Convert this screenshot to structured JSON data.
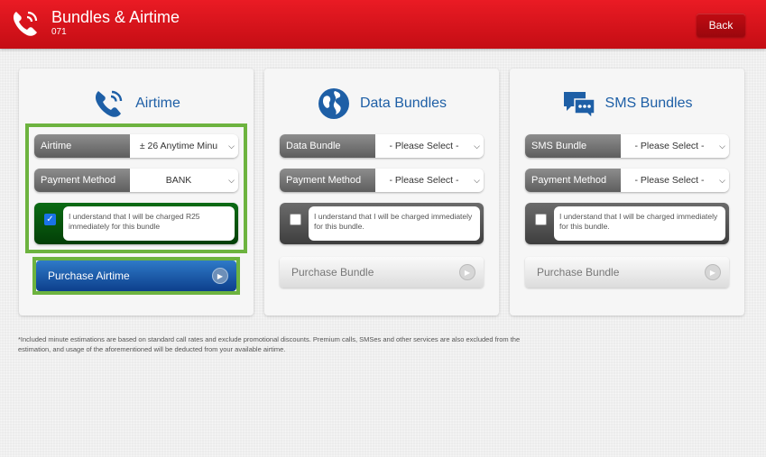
{
  "header": {
    "title": "Bundles & Airtime",
    "subtitle": "071",
    "back_label": "Back",
    "icon": "phone-icon",
    "color": "#d7141a"
  },
  "panels": {
    "airtime": {
      "title": "Airtime",
      "icon": "phone-icon",
      "fields": [
        {
          "label": "Airtime",
          "value": "± 26 Anytime Minu"
        },
        {
          "label": "Payment Method",
          "value": "BANK"
        }
      ],
      "agree_text": "I understand that I will be charged R25 immediately for this bundle",
      "agree_checked": true,
      "button": "Purchase Airtime"
    },
    "data": {
      "title": "Data Bundles",
      "icon": "globe-icon",
      "fields": [
        {
          "label": "Data Bundle",
          "value": "- Please Select -"
        },
        {
          "label": "Payment Method",
          "value": "- Please Select -"
        }
      ],
      "agree_text": "I understand that I will be charged immediately for this bundle.",
      "agree_checked": false,
      "button": "Purchase Bundle"
    },
    "sms": {
      "title": "SMS Bundles",
      "icon": "chat-icon",
      "fields": [
        {
          "label": "SMS Bundle",
          "value": "- Please Select -"
        },
        {
          "label": "Payment Method",
          "value": "- Please Select -"
        }
      ],
      "agree_text": "I understand that I will be charged immediately for this bundle.",
      "agree_checked": false,
      "button": "Purchase Bundle"
    }
  },
  "footnote": "*Included minute estimations are based on standard call rates and exclude promotional discounts. Premium calls, SMSes and other services are also excluded from the estimation, and usage of the aforementioned will be deducted from your available airtime.",
  "colors": {
    "accent_blue": "#1e5fa6",
    "highlight_green": "#6db33f",
    "brand_red": "#d7141a"
  }
}
